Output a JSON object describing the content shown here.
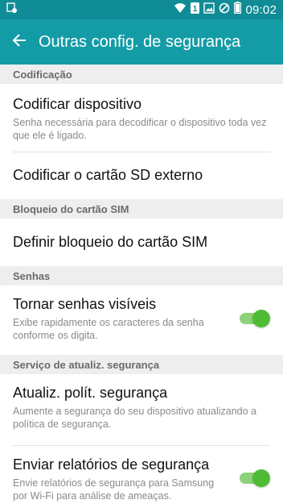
{
  "status_bar": {
    "time": "09:02",
    "sim_label": "1",
    "icons": [
      "notification-icon",
      "wifi-icon",
      "sim-icon",
      "image-icon",
      "blocked-icon",
      "battery-icon"
    ]
  },
  "app_bar": {
    "title": "Outras config. de segurança",
    "back_icon": "arrow-back-icon"
  },
  "sections": {
    "codificacao": {
      "header": "Codificação",
      "codificar_dispositivo": {
        "title": "Codificar dispositivo",
        "summary": "Senha necessária para decodificar o dispositivo toda vez que ele é ligado."
      },
      "codificar_sd": {
        "title": "Codificar o cartão SD externo"
      }
    },
    "bloqueio_sim": {
      "header": "Bloqueio do cartão SIM",
      "definir_bloqueio": {
        "title": "Definir bloqueio do cartão SIM"
      }
    },
    "senhas": {
      "header": "Senhas",
      "tornar_visiveis": {
        "title": "Tornar senhas visíveis",
        "summary": "Exibe rapidamente os caracteres da senha conforme os digita.",
        "switch_on": true
      }
    },
    "servico": {
      "header": "Serviço de atualiz. segurança",
      "atualiz_polit": {
        "title": "Atualiz. polít. segurança",
        "summary": "Aumente a segurança do seu dispositivo atualizando a política de segurança."
      },
      "enviar_relatorios": {
        "title": "Enviar relatórios de segurança",
        "summary": "Envie relatórios de segurança para Samsung por Wi-Fi para análise de ameaças.",
        "switch_on": true
      }
    }
  },
  "colors": {
    "status_bar": "#0f8c95",
    "app_bar": "#139ca6",
    "switch_thumb": "#4fbb35",
    "switch_track": "#8fd07a",
    "section_bg": "#eeeeee"
  }
}
